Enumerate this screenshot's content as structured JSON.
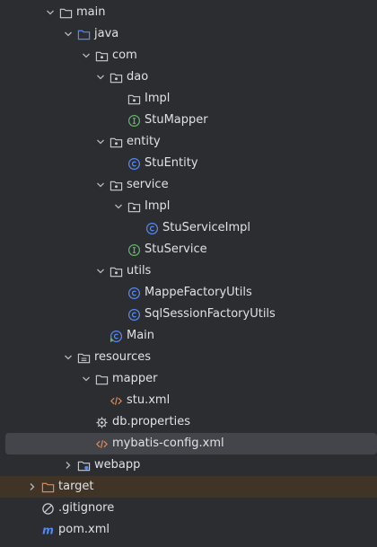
{
  "colors": {
    "background": "#2b2d30",
    "selection": "#43454a",
    "excluded_row": "#3f3426",
    "text": "#dfe1e5",
    "class_icon": "#548af7",
    "interface_icon": "#5fb865",
    "xml_icon": "#e08855",
    "folder_icon": "#c9ccd1"
  },
  "tree": {
    "nodes": [
      {
        "label": "main",
        "chevron": "down",
        "icon": "folder-icon"
      },
      {
        "label": "java",
        "chevron": "down",
        "icon": "source-folder-icon"
      },
      {
        "label": "com",
        "chevron": "down",
        "icon": "package-icon"
      },
      {
        "label": "dao",
        "chevron": "down",
        "icon": "package-icon"
      },
      {
        "label": "Impl",
        "chevron": "none",
        "icon": "package-icon"
      },
      {
        "label": "StuMapper",
        "chevron": "none",
        "icon": "interface-icon"
      },
      {
        "label": "entity",
        "chevron": "down",
        "icon": "package-icon"
      },
      {
        "label": "StuEntity",
        "chevron": "none",
        "icon": "class-icon"
      },
      {
        "label": "service",
        "chevron": "down",
        "icon": "package-icon"
      },
      {
        "label": "Impl",
        "chevron": "down",
        "icon": "package-icon"
      },
      {
        "label": "StuServiceImpl",
        "chevron": "none",
        "icon": "class-icon"
      },
      {
        "label": "StuService",
        "chevron": "none",
        "icon": "interface-icon"
      },
      {
        "label": "utils",
        "chevron": "down",
        "icon": "package-icon"
      },
      {
        "label": "MappeFactoryUtils",
        "chevron": "none",
        "icon": "class-icon"
      },
      {
        "label": "SqlSessionFactoryUtils",
        "chevron": "none",
        "icon": "class-icon"
      },
      {
        "label": "Main",
        "chevron": "none",
        "icon": "main-class-icon"
      },
      {
        "label": "resources",
        "chevron": "down",
        "icon": "resources-folder-icon"
      },
      {
        "label": "mapper",
        "chevron": "down",
        "icon": "folder-icon"
      },
      {
        "label": "stu.xml",
        "chevron": "none",
        "icon": "xml-file-icon"
      },
      {
        "label": "db.properties",
        "chevron": "none",
        "icon": "properties-file-icon"
      },
      {
        "label": "mybatis-config.xml",
        "chevron": "none",
        "icon": "xml-file-icon",
        "selected": true
      },
      {
        "label": "webapp",
        "chevron": "right",
        "icon": "web-folder-icon"
      },
      {
        "label": "target",
        "chevron": "right",
        "icon": "excluded-folder-icon",
        "excluded": true
      },
      {
        "label": ".gitignore",
        "chevron": "none",
        "icon": "gitignore-file-icon"
      },
      {
        "label": "pom.xml",
        "chevron": "none",
        "icon": "maven-file-icon"
      }
    ]
  }
}
